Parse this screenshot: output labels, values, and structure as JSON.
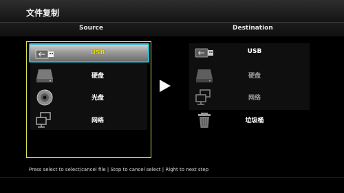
{
  "window": {
    "title": "文件复制"
  },
  "columns": {
    "source": "Source",
    "destination": "Destination"
  },
  "source": {
    "items": [
      {
        "label": "USB",
        "icon": "usb-drive-icon",
        "selected": true
      },
      {
        "label": "硬盘",
        "icon": "hard-disk-icon",
        "selected": false
      },
      {
        "label": "光盘",
        "icon": "optical-disc-icon",
        "selected": false
      },
      {
        "label": "网络",
        "icon": "network-icon",
        "selected": false
      }
    ]
  },
  "destination": {
    "items": [
      {
        "label": "USB",
        "icon": "usb-drive-icon",
        "dimmed": false
      },
      {
        "label": "硬盘",
        "icon": "hard-disk-icon",
        "dimmed": true
      },
      {
        "label": "网络",
        "icon": "network-icon",
        "dimmed": true
      },
      {
        "label": "垃圾桶",
        "icon": "trash-icon",
        "dimmed": false
      }
    ]
  },
  "hint": "Press select to select/cancel file | Stop to cancel select | Right to next step",
  "colors": {
    "focus_border": "#21b7d0",
    "panel_border": "#d9e24a",
    "selected_text": "#f4e300"
  }
}
